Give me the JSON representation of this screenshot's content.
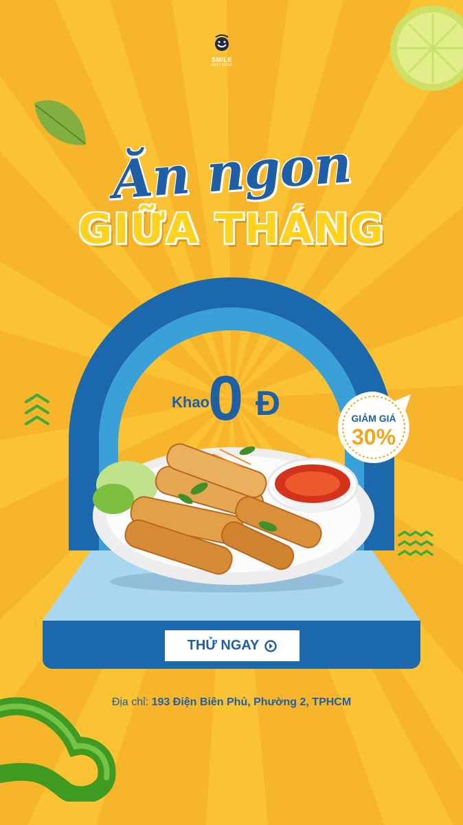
{
  "brand": {
    "name": "SMILE",
    "tagline": "FAST FOOD"
  },
  "headline": {
    "line1": "Ăn ngon",
    "line2": "GIỮA THÁNG"
  },
  "offer": {
    "prefix": "Khao",
    "amount": "0",
    "currency": "Đ"
  },
  "badge": {
    "label": "GIẢM GIÁ",
    "value": "30%"
  },
  "cta": {
    "label": "THỬ NGAY",
    "icon": "arrow-right-circle-icon"
  },
  "address": {
    "label": "Địa chỉ:",
    "value": "193 Điện Biên Phủ, Phường 2, TPHCM"
  },
  "colors": {
    "background": "#f7b52b",
    "primary_blue": "#1f5fa6",
    "light_blue": "#a9d7f2",
    "accent_yellow": "#ffd21f"
  }
}
